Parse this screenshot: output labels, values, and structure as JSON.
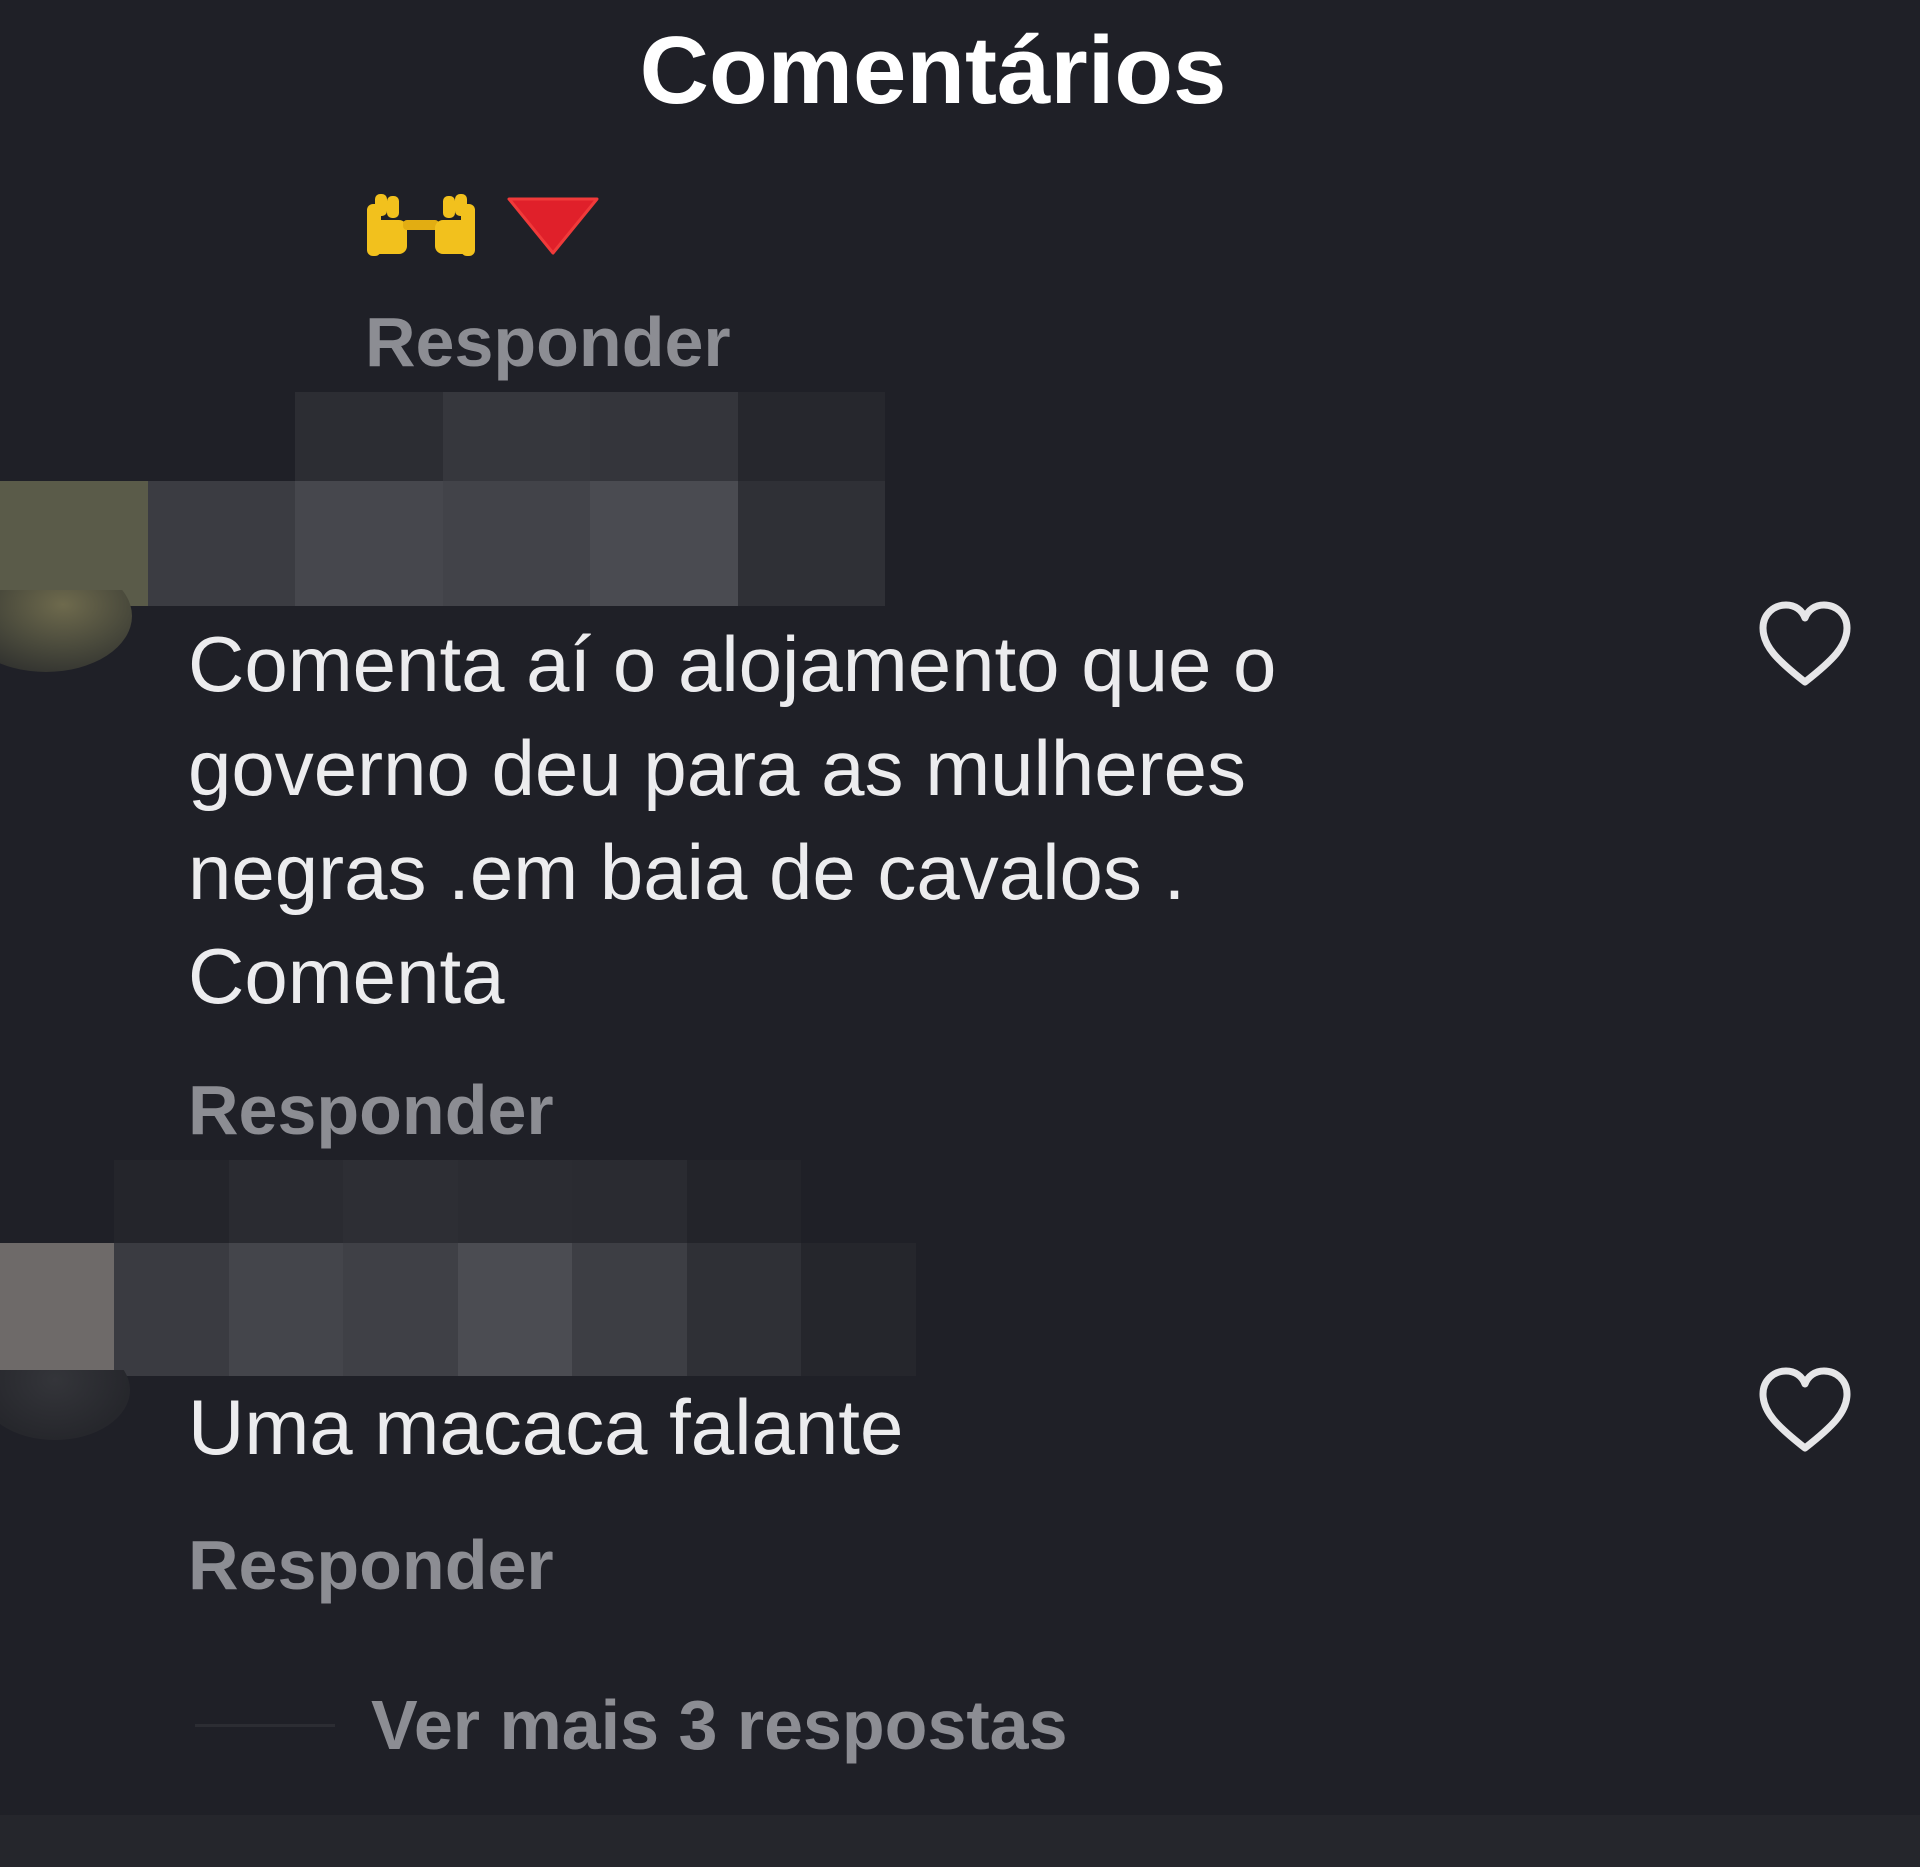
{
  "header": {
    "title": "Comentários"
  },
  "comments": [
    {
      "text": "",
      "emojis": [
        "raised-hands-icon",
        "red-triangle-down-icon"
      ],
      "reply_label": "Responder"
    },
    {
      "text": "Comenta aí o alojamento que o\ngoverno deu para as mulheres\nnegras .em baia de cavalos .\nComenta",
      "reply_label": "Responder"
    },
    {
      "text": "Uma macaca falante",
      "reply_label": "Responder"
    }
  ],
  "more_replies": {
    "label": "Ver mais 3 respostas"
  },
  "colors": {
    "background": "#1f2027",
    "text": "#ececee",
    "muted": "#8c8d93",
    "emoji_yellow": "#f2c11d",
    "emoji_red": "#e0202a"
  }
}
